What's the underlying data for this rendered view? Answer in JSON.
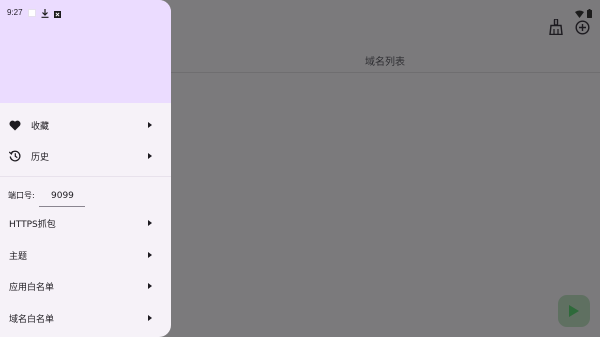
{
  "status_bar": {
    "time": "9:27"
  },
  "main": {
    "tab_title": "域名列表"
  },
  "drawer": {
    "items_top": [
      {
        "label": "收藏",
        "icon": "heart-icon"
      },
      {
        "label": "历史",
        "icon": "history-icon"
      }
    ],
    "port": {
      "label": "端口号:",
      "value": "9099"
    },
    "items_bottom": [
      {
        "label": "HTTPS抓包"
      },
      {
        "label": "主题"
      },
      {
        "label": "应用白名单"
      },
      {
        "label": "域名白名单"
      }
    ]
  },
  "colors": {
    "drawer_header": "#ebdcff",
    "drawer_bg": "#f6f2f8",
    "scrim_bg": "#7b7a7c",
    "fab_bg": "#5f7061",
    "fab_icon": "#2e6a3a"
  },
  "icons": {
    "toolbar": [
      "broom-icon",
      "add-circle-icon"
    ],
    "fab": "play-icon",
    "status": [
      "wifi-icon",
      "battery-icon",
      "download-icon",
      "app-notification-icon"
    ]
  }
}
